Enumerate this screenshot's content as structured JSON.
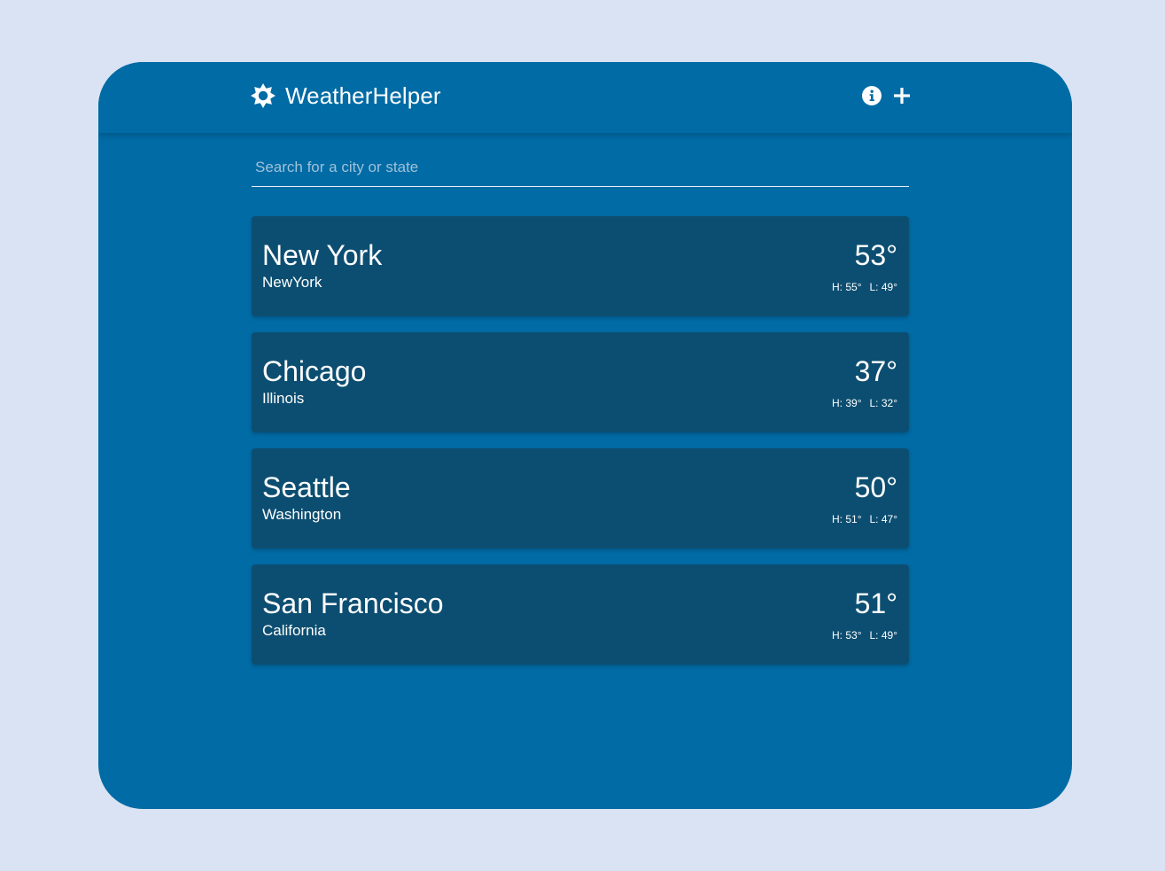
{
  "app": {
    "title": "WeatherHelper",
    "brand_icon": "sun-icon",
    "info_icon": "info-icon",
    "add_icon": "plus-icon"
  },
  "search": {
    "placeholder": "Search for a city or state",
    "value": ""
  },
  "cities": [
    {
      "name": "New York",
      "region": "NewYork",
      "temp": "53°",
      "high": "H: 55°",
      "low": "L: 49°"
    },
    {
      "name": "Chicago",
      "region": "Illinois",
      "temp": "37°",
      "high": "H: 39°",
      "low": "L: 32°"
    },
    {
      "name": "Seattle",
      "region": "Washington",
      "temp": "50°",
      "high": "H: 51°",
      "low": "L: 47°"
    },
    {
      "name": "San Francisco",
      "region": "California",
      "temp": "51°",
      "high": "H: 53°",
      "low": "L: 49°"
    }
  ],
  "colors": {
    "page_background": "#dae3f3",
    "app_background": "#016ba5",
    "card_background": "#0c4e71",
    "text": "#ffffff"
  }
}
